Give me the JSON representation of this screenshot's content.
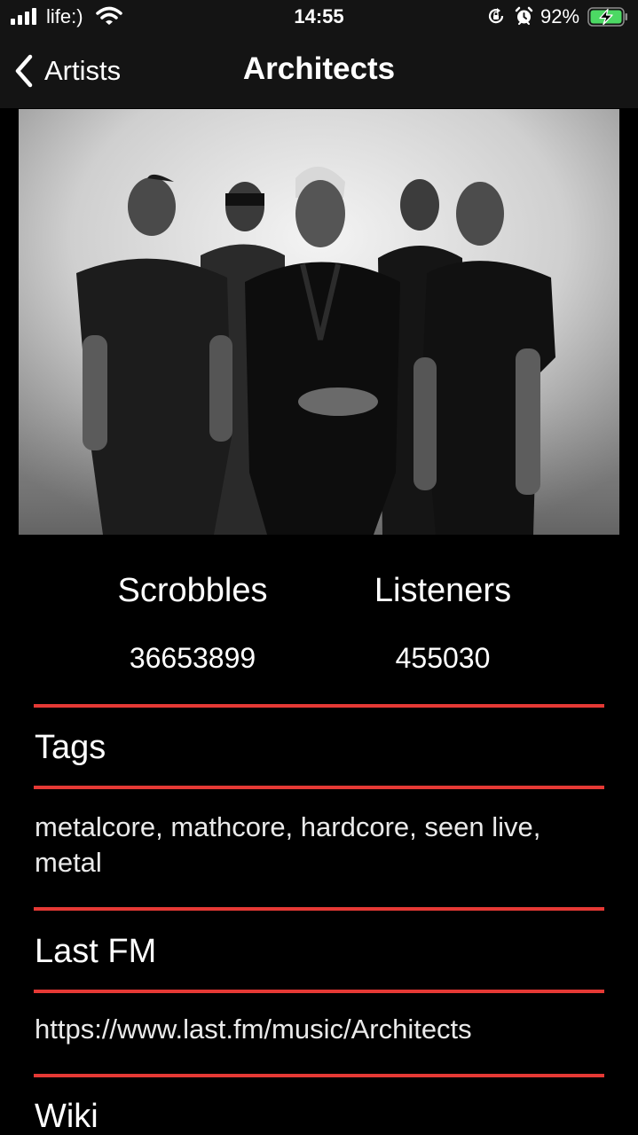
{
  "status_bar": {
    "carrier": "life:)",
    "time": "14:55",
    "battery": "92%"
  },
  "nav": {
    "back_label": "Artists",
    "title": "Architects"
  },
  "stats": {
    "scrobbles_label": "Scrobbles",
    "scrobbles_value": "36653899",
    "listeners_label": "Listeners",
    "listeners_value": "455030"
  },
  "sections": {
    "tags_header": "Tags",
    "tags_text": "metalcore, mathcore, hardcore, seen live, metal",
    "lastfm_header": "Last FM",
    "lastfm_url": "https://www.last.fm/music/Architects",
    "wiki_header": "Wiki"
  },
  "colors": {
    "accent": "#e53935",
    "background": "#000000",
    "bar_background": "#141414",
    "battery_charging": "#4cd964"
  },
  "icons": {
    "signal": "signal-icon",
    "wifi": "wifi-icon",
    "rotation_lock": "rotation-lock-icon",
    "alarm": "alarm-icon",
    "battery": "battery-charging-icon",
    "back": "chevron-left-icon"
  }
}
